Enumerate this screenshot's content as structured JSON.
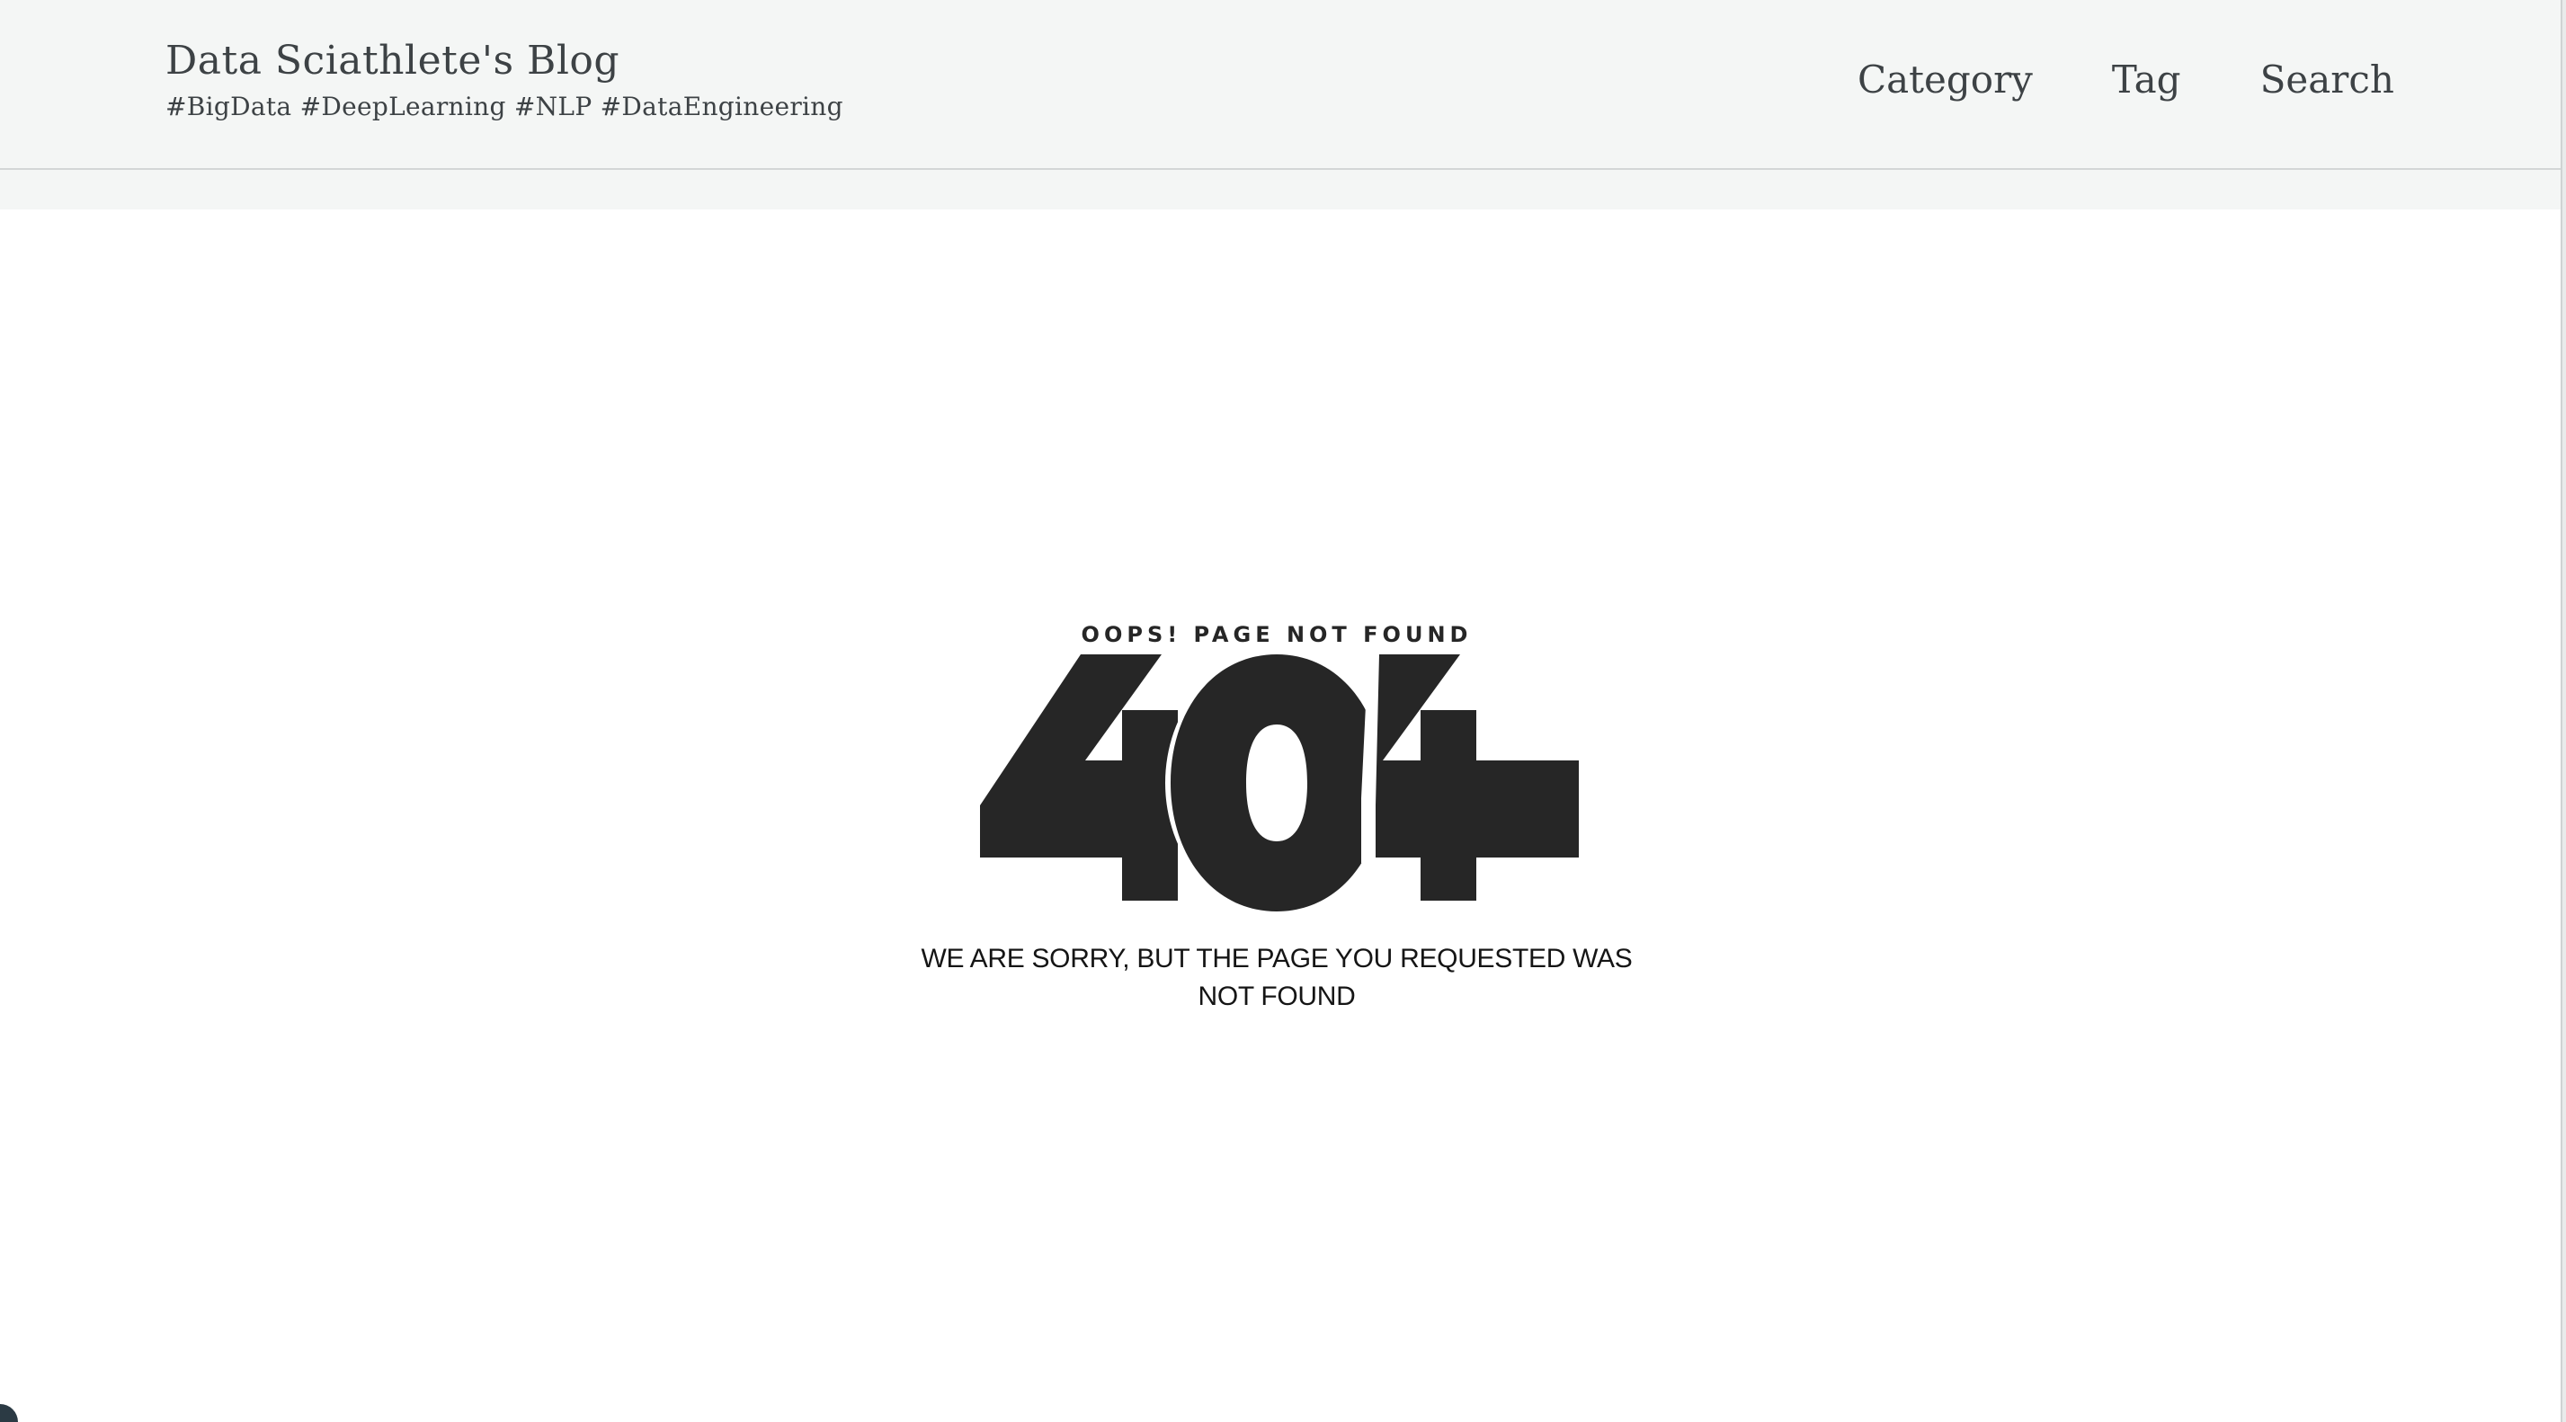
{
  "header": {
    "site_title": "Data Sciathlete's Blog",
    "site_tags": "#BigData  #DeepLearning  #NLP  #DataEngineering",
    "nav": [
      {
        "label": "Category"
      },
      {
        "label": "Tag"
      },
      {
        "label": "Search"
      }
    ]
  },
  "notfound": {
    "eyebrow": "OOPS! PAGE NOT FOUND",
    "code": "404",
    "message": "WE ARE SORRY, BUT THE PAGE YOU REQUESTED WAS NOT FOUND"
  },
  "colors": {
    "header_bg": "#f4f6f5",
    "text": "#3d4245",
    "digits": "#262626"
  }
}
